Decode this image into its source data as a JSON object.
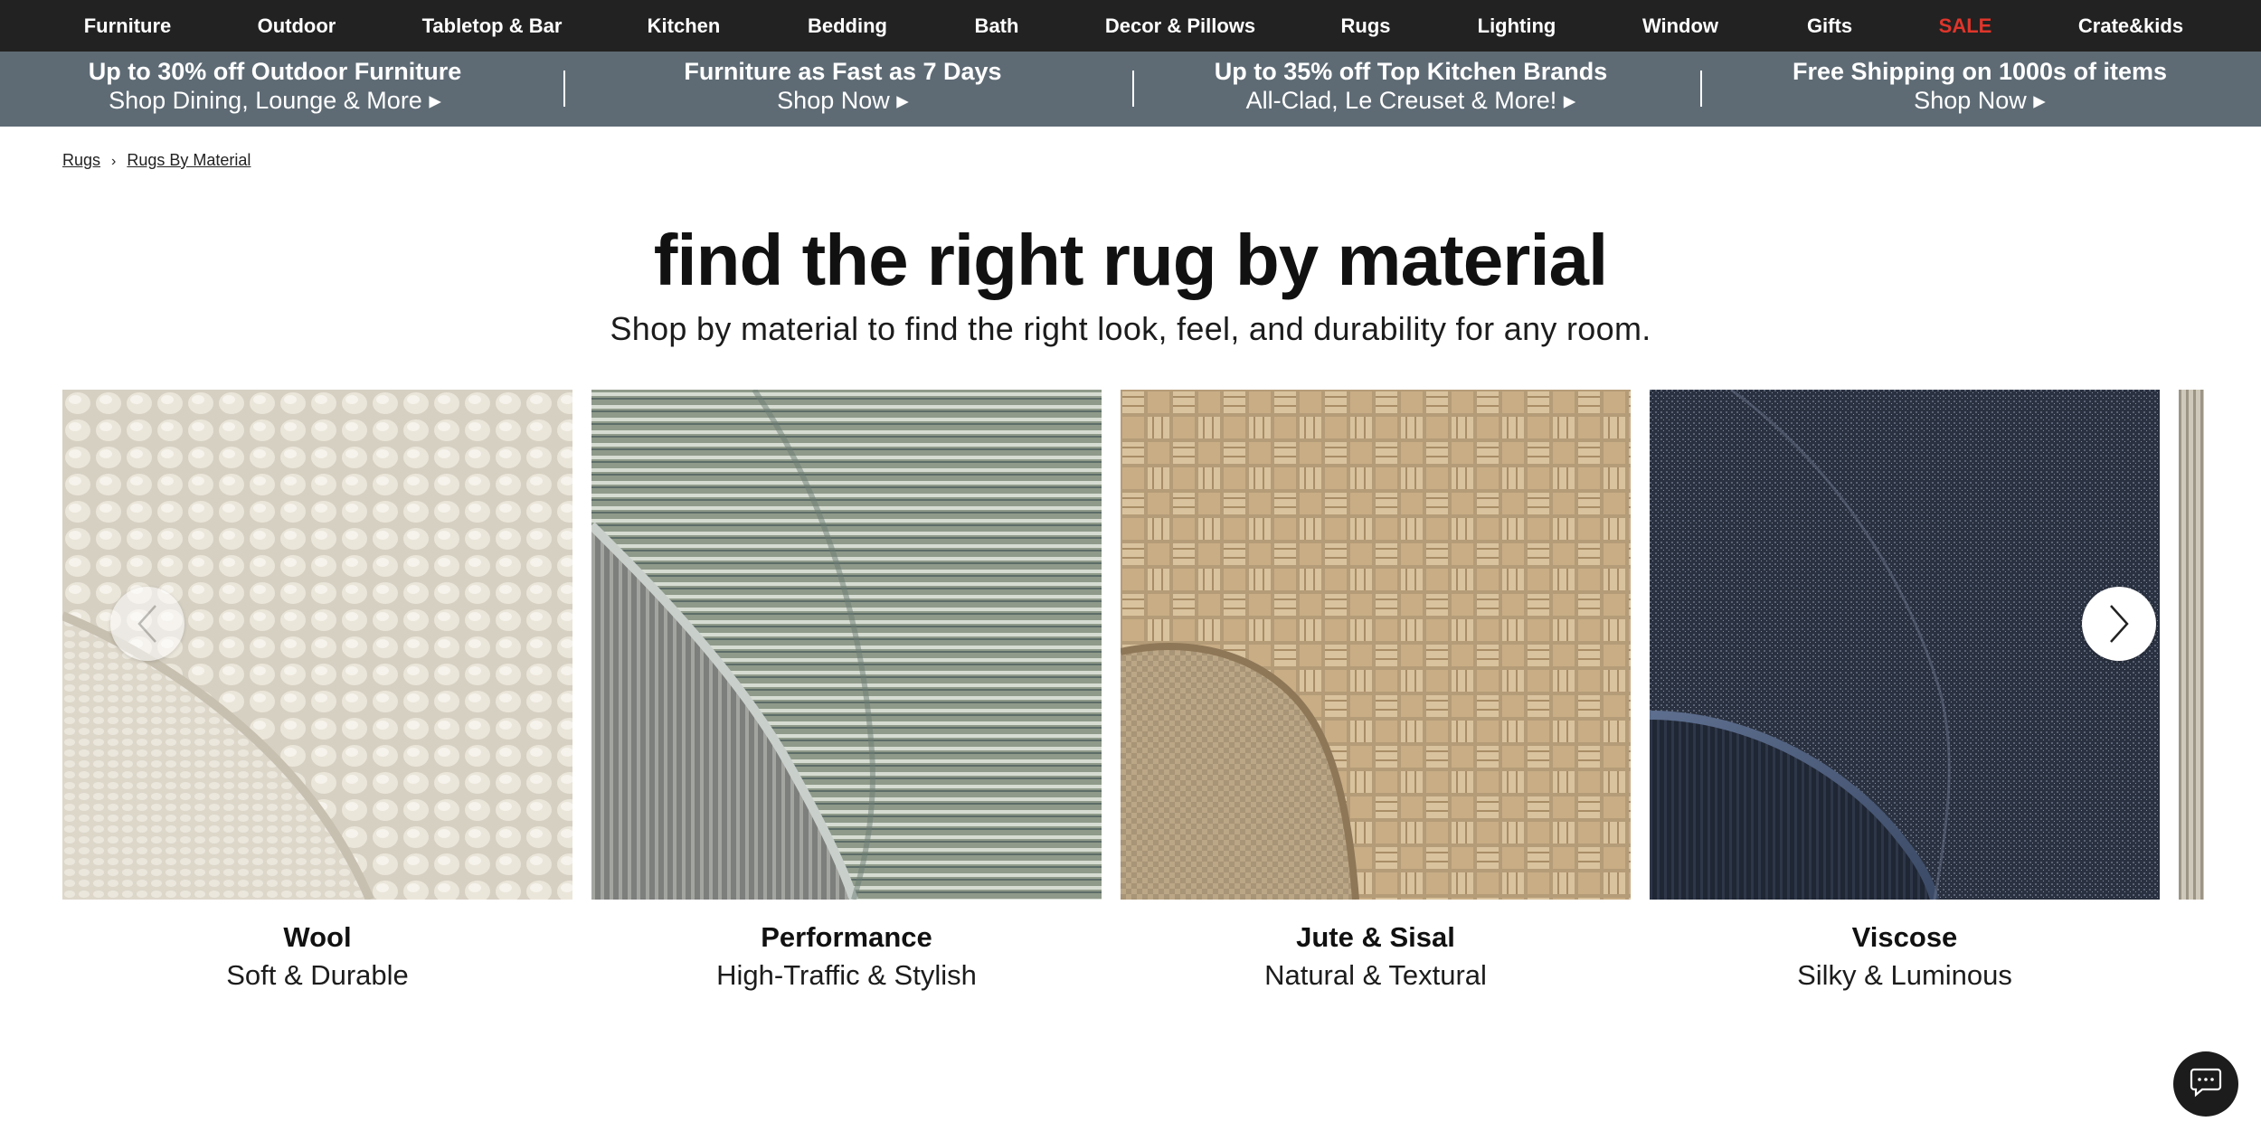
{
  "nav": {
    "items": [
      {
        "label": "Furniture"
      },
      {
        "label": "Outdoor"
      },
      {
        "label": "Tabletop & Bar"
      },
      {
        "label": "Kitchen"
      },
      {
        "label": "Bedding"
      },
      {
        "label": "Bath"
      },
      {
        "label": "Decor & Pillows"
      },
      {
        "label": "Rugs"
      },
      {
        "label": "Lighting"
      },
      {
        "label": "Window"
      },
      {
        "label": "Gifts"
      },
      {
        "label": "SALE"
      },
      {
        "label": "Crate&kids"
      }
    ],
    "sale_color": "#e0352b",
    "background": "#222222"
  },
  "promos": [
    {
      "title": "Up to 30% off Outdoor Furniture",
      "cta": "Shop Dining, Lounge & More ▸"
    },
    {
      "title": "Furniture as Fast as 7 Days",
      "cta": "Shop Now ▸"
    },
    {
      "title": "Up to 35% off Top Kitchen Brands",
      "cta": "All-Clad, Le Creuset & More! ▸"
    },
    {
      "title": "Free Shipping on 1000s of items",
      "cta": "Shop Now ▸"
    }
  ],
  "breadcrumb": {
    "items": [
      "Rugs",
      "Rugs By Material"
    ]
  },
  "page": {
    "title": "find the right rug by material",
    "subtitle": "Shop by material to find the right look, feel, and durability for any room."
  },
  "categories": [
    {
      "name": "Wool",
      "desc": "Soft & Durable",
      "icon": "wool-texture"
    },
    {
      "name": "Performance",
      "desc": "High-Traffic & Stylish",
      "icon": "performance-texture"
    },
    {
      "name": "Jute & Sisal",
      "desc": "Natural & Textural",
      "icon": "jute-texture"
    },
    {
      "name": "Viscose",
      "desc": "Silky & Luminous",
      "icon": "viscose-texture"
    }
  ],
  "controls": {
    "prev_icon": "chevron-left-icon",
    "next_icon": "chevron-right-icon",
    "chat_icon": "chat-bubble-icon"
  }
}
